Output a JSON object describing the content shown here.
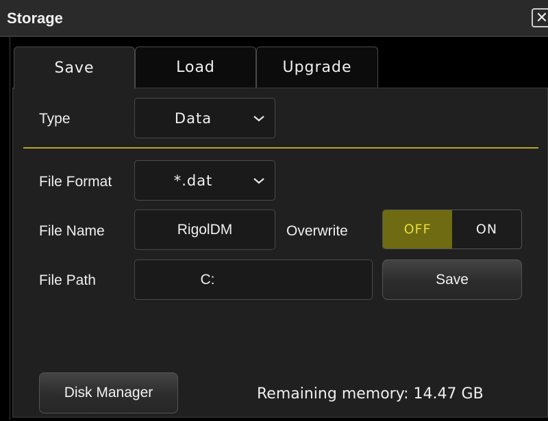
{
  "window": {
    "title": "Storage",
    "close_icon": "close-icon"
  },
  "tabs": [
    {
      "label": "Save",
      "active": true
    },
    {
      "label": "Load",
      "active": false
    },
    {
      "label": "Upgrade",
      "active": false
    }
  ],
  "form": {
    "type_label": "Type",
    "type_value": "Data",
    "file_format_label": "File Format",
    "file_format_value": "*.dat",
    "file_name_label": "File Name",
    "file_name_value": "RigolDM",
    "overwrite_label": "Overwrite",
    "overwrite_off": "OFF",
    "overwrite_on": "ON",
    "overwrite_state": "OFF",
    "file_path_label": "File Path",
    "file_path_value": "C:",
    "save_button": "Save"
  },
  "footer": {
    "disk_manager_button": "Disk Manager",
    "remaining_memory": "Remaining memory: 14.47 GB"
  },
  "colors": {
    "accent": "#b9a52b",
    "toggle_active_bg": "#6e6b12",
    "toggle_active_text": "#e8dc3a"
  }
}
